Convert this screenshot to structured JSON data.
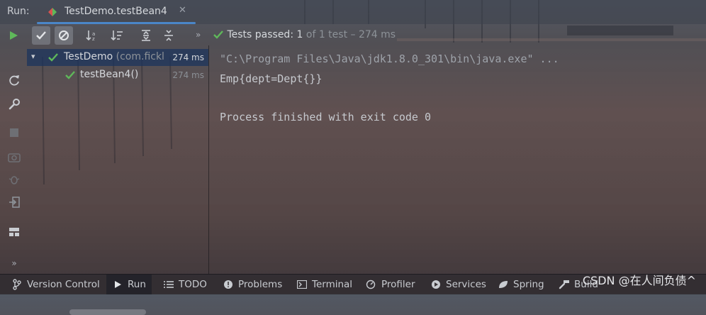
{
  "titlebar": {
    "run_label": "Run:",
    "tab_title": "TestDemo.testBean4",
    "tab_close": "✕"
  },
  "toolbar": {
    "more": "»"
  },
  "status": {
    "passed_label": "Tests passed:",
    "count_current": "1",
    "count_rest": "of 1 test – 274 ms"
  },
  "tree": {
    "root": {
      "name": "TestDemo",
      "package": "(com.fickl",
      "time": "274 ms",
      "expanded_arrow": "▾"
    },
    "child": {
      "name": "testBean4()",
      "time": "274 ms"
    }
  },
  "console": {
    "lines": [
      "\"C:\\Program Files\\Java\\jdk1.8.0_301\\bin\\java.exe\" ...",
      "Emp{dept=Dept{}}",
      "",
      "Process finished with exit code 0"
    ]
  },
  "gutter": {
    "more": "»"
  },
  "bottombar": {
    "items": [
      {
        "label": "Version Control",
        "icon": "version-control-icon"
      },
      {
        "label": "Run",
        "icon": "run-icon"
      },
      {
        "label": "TODO",
        "icon": "todo-icon"
      },
      {
        "label": "Problems",
        "icon": "problems-icon"
      },
      {
        "label": "Terminal",
        "icon": "terminal-icon"
      },
      {
        "label": "Profiler",
        "icon": "profiler-icon"
      },
      {
        "label": "Services",
        "icon": "services-icon"
      },
      {
        "label": "Spring",
        "icon": "spring-icon"
      },
      {
        "label": "Build",
        "icon": "build-icon"
      }
    ]
  },
  "watermark": "CSDN @在人间负债^",
  "colors": {
    "accent": "#4a86c8",
    "pass_green": "#5fb85a",
    "selected_row": "#1c345c"
  }
}
